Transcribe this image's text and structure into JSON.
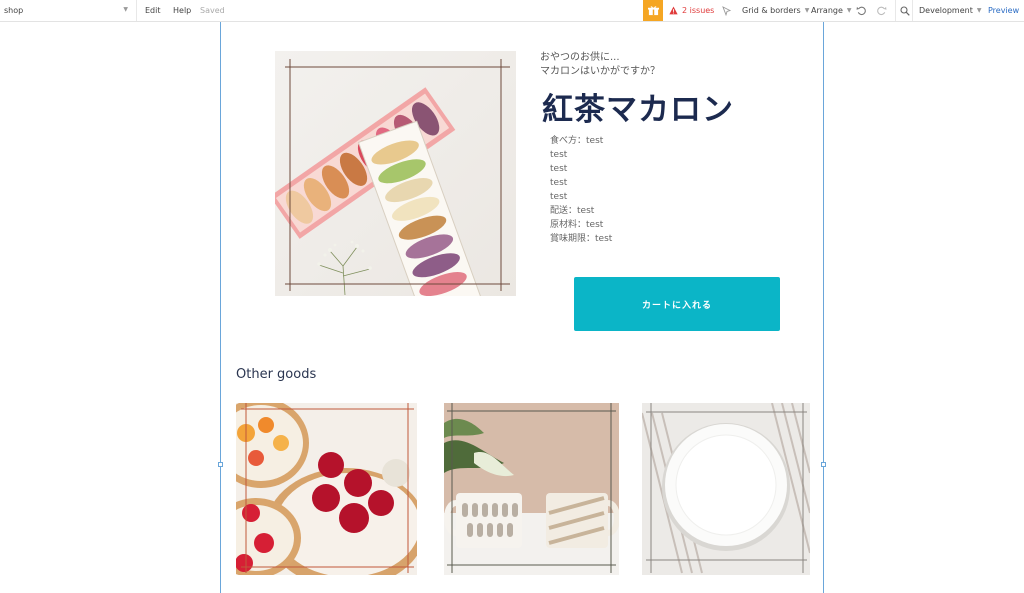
{
  "topbar": {
    "page_name": "shop",
    "menu": {
      "edit": "Edit",
      "help": "Help"
    },
    "save_status": "Saved",
    "issues": "2 issues",
    "grid_borders": "Grid & borders",
    "arrange": "Arrange",
    "environment": "Development",
    "preview": "Preview"
  },
  "product": {
    "intro_line1": "おやつのお供に...",
    "intro_line2": "マカロンはいかがですか？",
    "name": "紅茶マカロン",
    "details": [
      "食べ方：test",
      "test",
      "test",
      "test",
      "test",
      "配送：test",
      "原材料：test",
      "賞味期限：test"
    ],
    "cart_button": "カートに入れる"
  },
  "other_goods": {
    "heading": "Other goods"
  },
  "colors": {
    "accent": "#0bb5c7",
    "title": "#1c2a4f",
    "gift": "#f5a623",
    "warning": "#e03b3b",
    "guide": "#6aa6da"
  }
}
